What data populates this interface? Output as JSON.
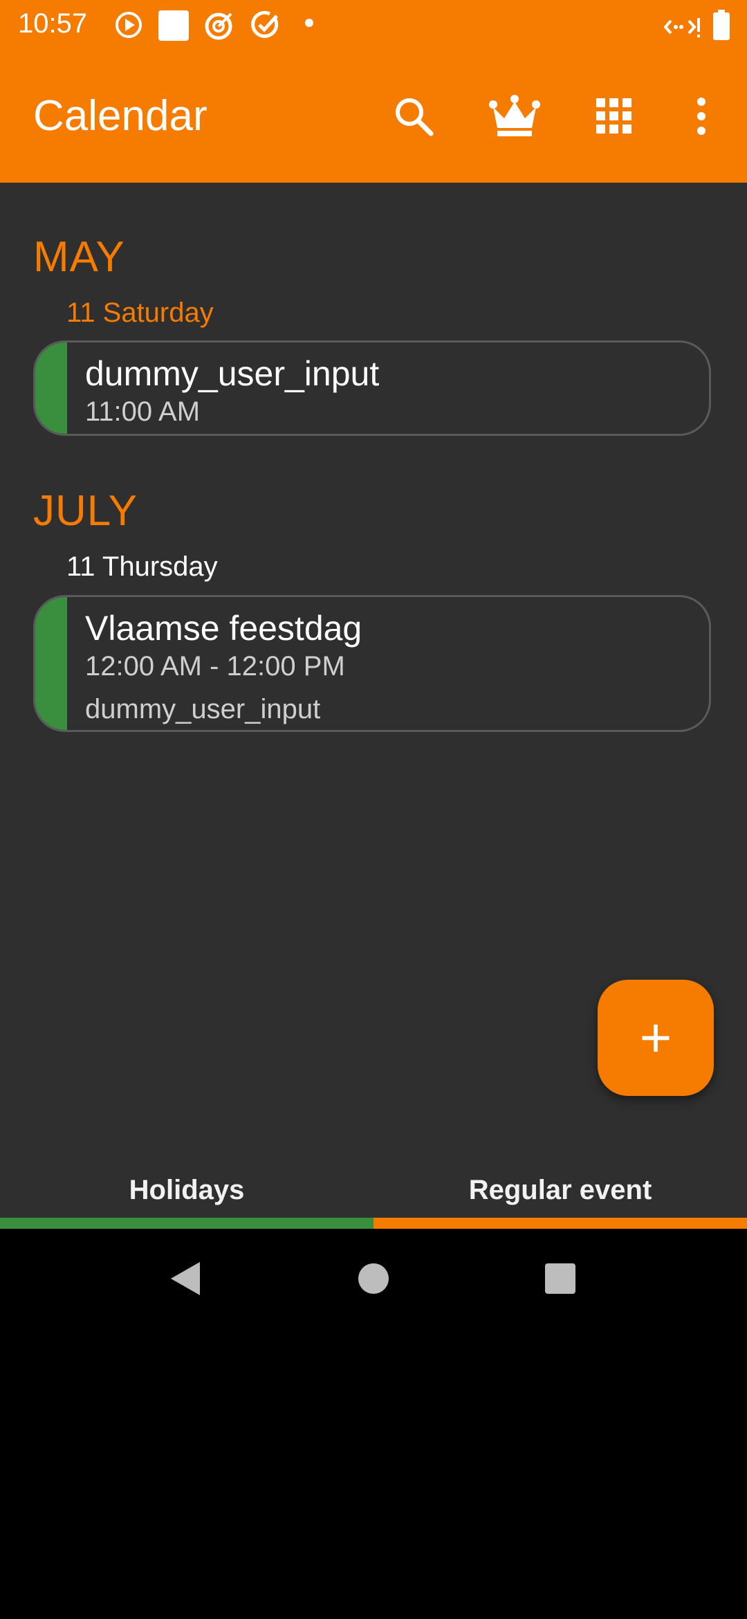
{
  "status_bar": {
    "time": "10:57",
    "icons": [
      "play-circle-icon",
      "square-icon",
      "target-icon",
      "check-circle-icon",
      "dot-icon",
      "signal-icon",
      "battery-icon"
    ]
  },
  "app_bar": {
    "title": "Calendar",
    "actions": [
      "search-icon",
      "crown-icon",
      "grid-icon",
      "more-vert-icon"
    ]
  },
  "sections": [
    {
      "month": "MAY",
      "day": "11 Saturday",
      "day_color": "#f57c00",
      "events": [
        {
          "title": "dummy_user_input",
          "time": "11:00 AM"
        }
      ]
    },
    {
      "month": "JULY",
      "day": "11 Thursday",
      "day_color": "#ffffff",
      "events": [
        {
          "title": "Vlaamse feestdag",
          "time": "12:00 AM - 12:00 PM",
          "note": "dummy_user_input"
        }
      ]
    }
  ],
  "fab": {
    "label": "+"
  },
  "tabs": [
    {
      "label": "Holidays",
      "color": "#3a8f3e"
    },
    {
      "label": "Regular event",
      "color": "#f57c00"
    }
  ],
  "nav": [
    "back-icon",
    "home-icon",
    "recents-icon"
  ],
  "colors": {
    "accent": "#f57c00",
    "background": "#2f2f30",
    "holiday_green": "#3a8f3e"
  }
}
